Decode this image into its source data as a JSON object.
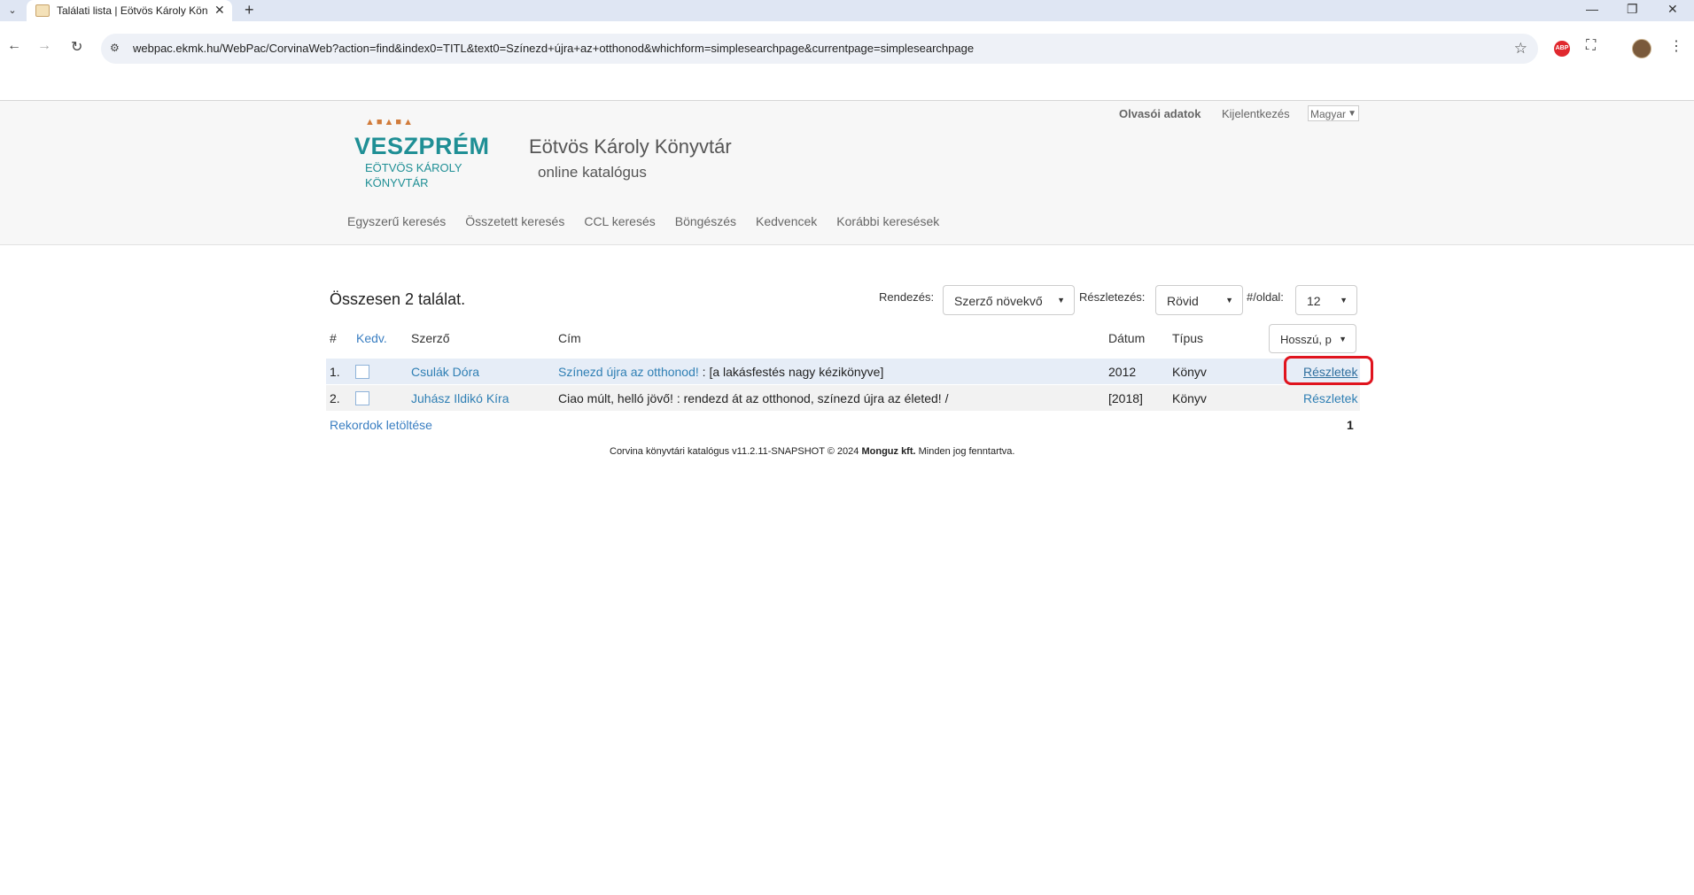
{
  "browser": {
    "tab_title": "Találati lista | Eötvös Károly Kön",
    "url": "webpac.ekmk.hu/WebPac/CorvinaWeb?action=find&index0=TITL&text0=Színezd+újra+az+otthonod&whichform=simplesearchpage&currentpage=simplesearchpage",
    "abp_label": "ABP"
  },
  "header": {
    "logo_main": "VESZPRÉM",
    "logo_sub1": "EÖTVÖS KÁROLY",
    "logo_sub2": "KÖNYVTÁR",
    "title": "Eötvös Károly Könyvtár",
    "subtitle": "online katalógus",
    "user_links": {
      "reader_data": "Olvasói adatok",
      "logout": "Kijelentkezés",
      "language": "Magyar"
    },
    "nav": [
      "Egyszerű keresés",
      "Összetett keresés",
      "CCL keresés",
      "Böngészés",
      "Kedvencek",
      "Korábbi keresések"
    ]
  },
  "results": {
    "summary": "Összesen 2 találat.",
    "sort_label": "Rendezés:",
    "sort_value": "Szerző növekvő",
    "detail_label": "Részletezés:",
    "detail_value": "Rövid",
    "per_page_label": "#/oldal:",
    "per_page_value": "12",
    "columns": {
      "num": "#",
      "fav": "Kedv.",
      "author": "Szerző",
      "title": "Cím",
      "date": "Dátum",
      "type": "Típus",
      "format": "Hosszú, p"
    },
    "rows": [
      {
        "num": "1.",
        "author": "Csulák Dóra",
        "title_link": "Színezd újra az otthonod!",
        "title_rest": " : [a lakásfestés nagy kézikönyve]",
        "date": "2012",
        "type": "Könyv",
        "details": "Részletek"
      },
      {
        "num": "2.",
        "author": "Juhász Ildikó Kíra",
        "title_link": "",
        "title_rest": "Ciao múlt, helló jövő! : rendezd át az otthonod, színezd újra az életed! /",
        "date": "[2018]",
        "type": "Könyv",
        "details": "Részletek"
      }
    ],
    "download": "Rekordok letöltése",
    "page": "1"
  },
  "footer": {
    "prefix": "Corvina könyvtári katalógus v11.2.11-SNAPSHOT © 2024 ",
    "company": "Monguz kft.",
    "suffix": " Minden jog fenntartva."
  },
  "colors": {
    "highlight": "#e0141e",
    "link": "#2f7fb4",
    "brand": "#1f8f95"
  }
}
